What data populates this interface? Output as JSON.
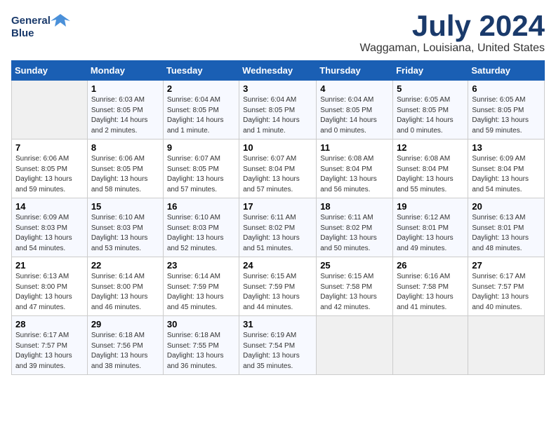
{
  "logo": {
    "line1": "General",
    "line2": "Blue"
  },
  "title": "July 2024",
  "subtitle": "Waggaman, Louisiana, United States",
  "days_of_week": [
    "Sunday",
    "Monday",
    "Tuesday",
    "Wednesday",
    "Thursday",
    "Friday",
    "Saturday"
  ],
  "weeks": [
    [
      {
        "day": "",
        "info": ""
      },
      {
        "day": "1",
        "info": "Sunrise: 6:03 AM\nSunset: 8:05 PM\nDaylight: 14 hours\nand 2 minutes."
      },
      {
        "day": "2",
        "info": "Sunrise: 6:04 AM\nSunset: 8:05 PM\nDaylight: 14 hours\nand 1 minute."
      },
      {
        "day": "3",
        "info": "Sunrise: 6:04 AM\nSunset: 8:05 PM\nDaylight: 14 hours\nand 1 minute."
      },
      {
        "day": "4",
        "info": "Sunrise: 6:04 AM\nSunset: 8:05 PM\nDaylight: 14 hours\nand 0 minutes."
      },
      {
        "day": "5",
        "info": "Sunrise: 6:05 AM\nSunset: 8:05 PM\nDaylight: 14 hours\nand 0 minutes."
      },
      {
        "day": "6",
        "info": "Sunrise: 6:05 AM\nSunset: 8:05 PM\nDaylight: 13 hours\nand 59 minutes."
      }
    ],
    [
      {
        "day": "7",
        "info": "Sunrise: 6:06 AM\nSunset: 8:05 PM\nDaylight: 13 hours\nand 59 minutes."
      },
      {
        "day": "8",
        "info": "Sunrise: 6:06 AM\nSunset: 8:05 PM\nDaylight: 13 hours\nand 58 minutes."
      },
      {
        "day": "9",
        "info": "Sunrise: 6:07 AM\nSunset: 8:05 PM\nDaylight: 13 hours\nand 57 minutes."
      },
      {
        "day": "10",
        "info": "Sunrise: 6:07 AM\nSunset: 8:04 PM\nDaylight: 13 hours\nand 57 minutes."
      },
      {
        "day": "11",
        "info": "Sunrise: 6:08 AM\nSunset: 8:04 PM\nDaylight: 13 hours\nand 56 minutes."
      },
      {
        "day": "12",
        "info": "Sunrise: 6:08 AM\nSunset: 8:04 PM\nDaylight: 13 hours\nand 55 minutes."
      },
      {
        "day": "13",
        "info": "Sunrise: 6:09 AM\nSunset: 8:04 PM\nDaylight: 13 hours\nand 54 minutes."
      }
    ],
    [
      {
        "day": "14",
        "info": "Sunrise: 6:09 AM\nSunset: 8:03 PM\nDaylight: 13 hours\nand 54 minutes."
      },
      {
        "day": "15",
        "info": "Sunrise: 6:10 AM\nSunset: 8:03 PM\nDaylight: 13 hours\nand 53 minutes."
      },
      {
        "day": "16",
        "info": "Sunrise: 6:10 AM\nSunset: 8:03 PM\nDaylight: 13 hours\nand 52 minutes."
      },
      {
        "day": "17",
        "info": "Sunrise: 6:11 AM\nSunset: 8:02 PM\nDaylight: 13 hours\nand 51 minutes."
      },
      {
        "day": "18",
        "info": "Sunrise: 6:11 AM\nSunset: 8:02 PM\nDaylight: 13 hours\nand 50 minutes."
      },
      {
        "day": "19",
        "info": "Sunrise: 6:12 AM\nSunset: 8:01 PM\nDaylight: 13 hours\nand 49 minutes."
      },
      {
        "day": "20",
        "info": "Sunrise: 6:13 AM\nSunset: 8:01 PM\nDaylight: 13 hours\nand 48 minutes."
      }
    ],
    [
      {
        "day": "21",
        "info": "Sunrise: 6:13 AM\nSunset: 8:00 PM\nDaylight: 13 hours\nand 47 minutes."
      },
      {
        "day": "22",
        "info": "Sunrise: 6:14 AM\nSunset: 8:00 PM\nDaylight: 13 hours\nand 46 minutes."
      },
      {
        "day": "23",
        "info": "Sunrise: 6:14 AM\nSunset: 7:59 PM\nDaylight: 13 hours\nand 45 minutes."
      },
      {
        "day": "24",
        "info": "Sunrise: 6:15 AM\nSunset: 7:59 PM\nDaylight: 13 hours\nand 44 minutes."
      },
      {
        "day": "25",
        "info": "Sunrise: 6:15 AM\nSunset: 7:58 PM\nDaylight: 13 hours\nand 42 minutes."
      },
      {
        "day": "26",
        "info": "Sunrise: 6:16 AM\nSunset: 7:58 PM\nDaylight: 13 hours\nand 41 minutes."
      },
      {
        "day": "27",
        "info": "Sunrise: 6:17 AM\nSunset: 7:57 PM\nDaylight: 13 hours\nand 40 minutes."
      }
    ],
    [
      {
        "day": "28",
        "info": "Sunrise: 6:17 AM\nSunset: 7:57 PM\nDaylight: 13 hours\nand 39 minutes."
      },
      {
        "day": "29",
        "info": "Sunrise: 6:18 AM\nSunset: 7:56 PM\nDaylight: 13 hours\nand 38 minutes."
      },
      {
        "day": "30",
        "info": "Sunrise: 6:18 AM\nSunset: 7:55 PM\nDaylight: 13 hours\nand 36 minutes."
      },
      {
        "day": "31",
        "info": "Sunrise: 6:19 AM\nSunset: 7:54 PM\nDaylight: 13 hours\nand 35 minutes."
      },
      {
        "day": "",
        "info": ""
      },
      {
        "day": "",
        "info": ""
      },
      {
        "day": "",
        "info": ""
      }
    ]
  ]
}
